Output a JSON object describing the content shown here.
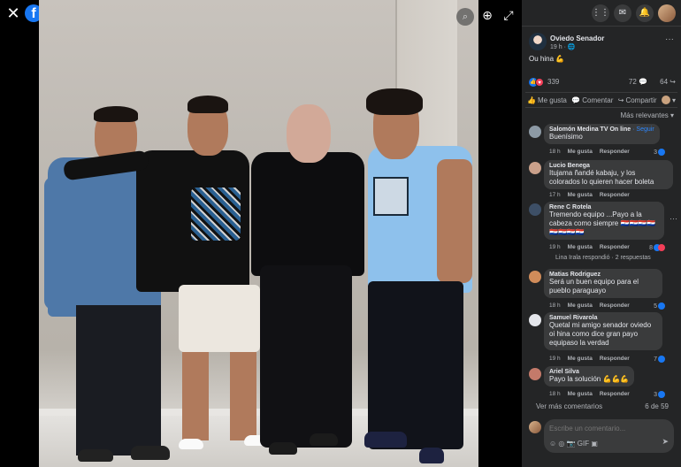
{
  "viewer": {
    "close": "✕",
    "logo": "f",
    "zoom_in": "⊕",
    "expand": "⤢",
    "photo_zoom": "⌕"
  },
  "topbar": {
    "menu": "⋮⋮",
    "messenger": "✉",
    "notifications": "🔔"
  },
  "post": {
    "author": "Oviedo Senador",
    "meta": "19 h · 🌐",
    "more": "···",
    "text": "Ou hina 💪",
    "reactions": "339",
    "comments": "72 💬",
    "shares": "64 ↪"
  },
  "actions": {
    "like": "Me gusta",
    "comment": "Comentar",
    "share": "Compartir"
  },
  "sort_label": "Más relevantes ▾",
  "comments": [
    {
      "name": "Salomón Medina TV On line",
      "follow": "· Seguir",
      "text": "Buenísimo",
      "time": "18 h",
      "like": "Me gusta",
      "reply": "Responder",
      "reacts": "3",
      "avatar": "#8d9aa5"
    },
    {
      "name": "Lucio Benega",
      "text": "Itujama ñandé kabaju, y los colorados lo quieren hacer boleta",
      "time": "17 h",
      "like": "Me gusta",
      "reply": "Responder",
      "reacts": "",
      "avatar": "#c9a08a"
    },
    {
      "name": "Rene C Rotela",
      "text": "Tremendo equipo ...Payo a la cabeza como siempre 🇵🇾🇵🇾🇵🇾🇵🇾🇵🇾🇵🇾🇵🇾🇵🇾",
      "time": "19 h",
      "like": "Me gusta",
      "reply": "Responder",
      "reacts": "8",
      "avatar": "#3d4f66"
    },
    {
      "name": "Matias Rodriguez",
      "text": "Será un buen equipo para el pueblo paraguayo",
      "time": "18 h",
      "like": "Me gusta",
      "reply": "Responder",
      "reacts": "5",
      "avatar": "#d08c5a"
    },
    {
      "name": "Samuel Rivarola",
      "text": "Quetal mi amigo senador oviedo oi hina como dice gran payo equipaso la verdad",
      "time": "19 h",
      "like": "Me gusta",
      "reply": "Responder",
      "reacts": "7",
      "avatar": "#e4e6eb"
    },
    {
      "name": "Ariel Silva",
      "text": "Payo la solución 💪💪💪",
      "time": "18 h",
      "like": "Me gusta",
      "reply": "Responder",
      "reacts": "3",
      "avatar": "#c47a6a"
    }
  ],
  "reply_thread": "Lina Irala respondió · 2 respuestas",
  "more_comments": "Ver más comentarios",
  "page_count": "6 de 59",
  "composer": {
    "placeholder": "Escribe un comentario...",
    "icons": "☺ ◎ 📷 GIF ▣",
    "send": "➤"
  }
}
